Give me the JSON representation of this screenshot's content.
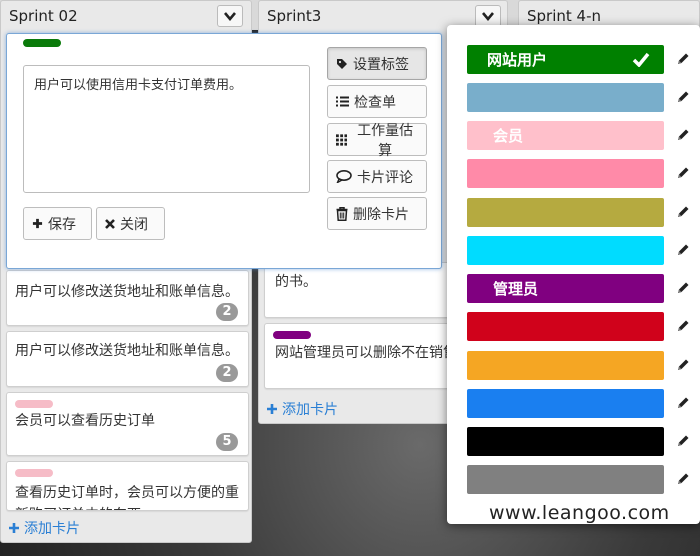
{
  "lanes": [
    {
      "title": "Sprint 02"
    },
    {
      "title": "Sprint3"
    },
    {
      "title": "Sprint 4-n"
    }
  ],
  "editor": {
    "text": "用户可以使用信用卡支付订单费用。",
    "save_label": "保存",
    "close_label": "关闭",
    "actions": [
      {
        "label": "设置标签",
        "icon": "tag-icon"
      },
      {
        "label": "检查单",
        "icon": "list-icon"
      },
      {
        "label": "工作量估算",
        "icon": "grid-icon"
      },
      {
        "label": "卡片评论",
        "icon": "comment-icon"
      },
      {
        "label": "删除卡片",
        "icon": "trash-icon"
      }
    ]
  },
  "lane1_cards": [
    {
      "text": "用户可以修改送货地址和账单信息。",
      "badge": "2"
    },
    {
      "text": "用户可以修改送货地址和账单信息。",
      "badge": "2"
    },
    {
      "text": "会员可以查看历史订单",
      "badge": "5",
      "tag_color": "#f6bcc7"
    },
    {
      "text": "查看历史订单时，会员可以方便的重新购买订单中的东西",
      "tag_color": "#f6bcc7"
    }
  ],
  "lane2_cards": [
    {
      "text": "的书。"
    },
    {
      "text": "网站管理员可以删除不在销售",
      "tag_color": "#800080"
    }
  ],
  "add_card_label": "添加卡片",
  "labels": [
    {
      "name": "网站用户",
      "color": "#008000",
      "selected": true
    },
    {
      "name": "",
      "color": "#79aecb"
    },
    {
      "name": "会员",
      "color": "#ffc0cb"
    },
    {
      "name": "",
      "color": "#ff8aa8"
    },
    {
      "name": "",
      "color": "#b5aa40"
    },
    {
      "name": "",
      "color": "#00dcff"
    },
    {
      "name": "管理员",
      "color": "#800080"
    },
    {
      "name": "",
      "color": "#d0021b"
    },
    {
      "name": "",
      "color": "#f5a623"
    },
    {
      "name": "",
      "color": "#1a7ff0"
    },
    {
      "name": "",
      "color": "#000000"
    },
    {
      "name": "",
      "color": "#808080"
    }
  ],
  "watermark": "www.leangoo.com"
}
